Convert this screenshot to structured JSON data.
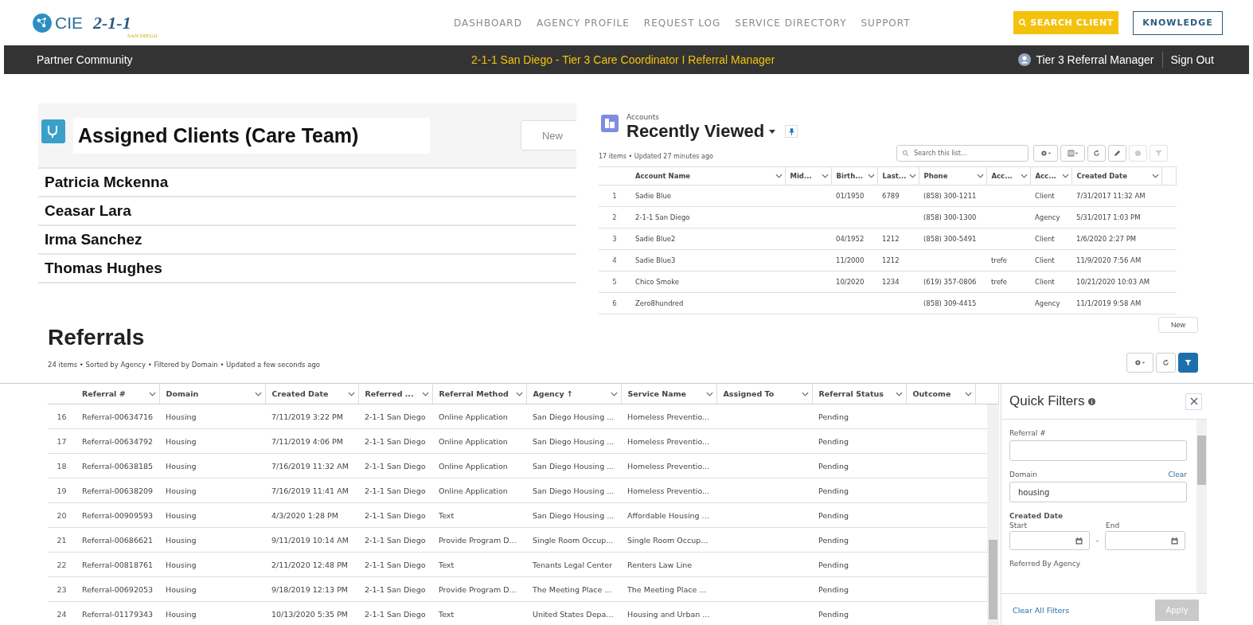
{
  "header": {
    "logo": {
      "brand": "CIE",
      "mark": "2-1-1",
      "tagline": "SAN DIEGO"
    },
    "nav": [
      {
        "label": "DASHBOARD"
      },
      {
        "label": "AGENCY PROFILE"
      },
      {
        "label": "REQUEST LOG"
      },
      {
        "label": "SERVICE DIRECTORY"
      },
      {
        "label": "SUPPORT"
      }
    ],
    "search_button": "SEARCH CLIENT",
    "knowledge_button": "KNOWLEDGE"
  },
  "subbar": {
    "community": "Partner Community",
    "title": "2-1-1 San Diego - Tier 3 Care Coordinator I Referral Manager",
    "user": "Tier 3 Referral Manager",
    "sign_out": "Sign Out"
  },
  "assigned_clients": {
    "title": "Assigned Clients  (Care Team)",
    "new_button": "New",
    "clients": [
      "Patricia Mckenna",
      "Ceasar Lara",
      "Irma Sanchez",
      "Thomas Hughes"
    ]
  },
  "accounts": {
    "object_label": "Accounts",
    "title": "Recently Viewed",
    "summary": "17 items • Updated 27 minutes ago",
    "search": {
      "placeholder": "Search this list..."
    },
    "columns": [
      "Account Name",
      "Mid...",
      "Birth...",
      "Last...",
      "Phone",
      "Acc...",
      "Acc...",
      "Created Date"
    ],
    "rows": [
      {
        "number": "1",
        "cells": [
          "Sadie Blue",
          "",
          "01/1950",
          "6789",
          "(858) 300-1211",
          "",
          "Client",
          "7/31/2017 11:32 AM"
        ]
      },
      {
        "number": "2",
        "cells": [
          "2-1-1 San Diego",
          "",
          "",
          "",
          "(858) 300-1300",
          "",
          "Agency",
          "5/31/2017 1:03 PM"
        ]
      },
      {
        "number": "3",
        "cells": [
          "Sadie Blue2",
          "",
          "04/1952",
          "1212",
          "(858) 300-5491",
          "",
          "Client",
          "1/6/2020 2:27 PM"
        ]
      },
      {
        "number": "4",
        "cells": [
          "Sadie Blue3",
          "",
          "11/2000",
          "1212",
          "",
          "trefe",
          "Client",
          "11/9/2020 7:56 AM"
        ]
      },
      {
        "number": "5",
        "cells": [
          "Chico Smoke",
          "",
          "10/2020",
          "1234",
          "(619) 357-0806",
          "trefe",
          "Client",
          "10/21/2020 10:03 AM"
        ]
      },
      {
        "number": "6",
        "cells": [
          "Zero8hundred",
          "",
          "",
          "",
          "(858) 309-4415",
          "",
          "Agency",
          "11/1/2019 9:58 AM"
        ]
      }
    ]
  },
  "referrals": {
    "title": "Referrals",
    "new_button": "New",
    "summary": "24 items • Sorted by Agency • Filtered by Domain • Updated a few seconds ago",
    "filter_active": true,
    "columns": [
      "Referral #",
      "Domain",
      "Created Date",
      "Referred ...",
      "Referral Method",
      "Agency ↑",
      "Service Name",
      "Assigned To",
      "Referral Status",
      "Outcome"
    ],
    "rows": [
      {
        "number": "16",
        "cells": [
          "Referral-00634716",
          "Housing",
          "7/11/2019 3:22 PM",
          "2-1-1 San Diego",
          "Online Application",
          "San Diego Housing ...",
          "Homeless Preventio...",
          "",
          "Pending",
          ""
        ]
      },
      {
        "number": "17",
        "cells": [
          "Referral-00634792",
          "Housing",
          "7/11/2019 4:06 PM",
          "2-1-1 San Diego",
          "Online Application",
          "San Diego Housing ...",
          "Homeless Preventio...",
          "",
          "Pending",
          ""
        ]
      },
      {
        "number": "18",
        "cells": [
          "Referral-00638185",
          "Housing",
          "7/16/2019 11:32 AM",
          "2-1-1 San Diego",
          "Online Application",
          "San Diego Housing ...",
          "Homeless Preventio...",
          "",
          "Pending",
          ""
        ]
      },
      {
        "number": "19",
        "cells": [
          "Referral-00638209",
          "Housing",
          "7/16/2019 11:41 AM",
          "2-1-1 San Diego",
          "Online Application",
          "San Diego Housing ...",
          "Homeless Preventio...",
          "",
          "Pending",
          ""
        ]
      },
      {
        "number": "20",
        "cells": [
          "Referral-00909593",
          "Housing",
          "4/3/2020 1:28 PM",
          "2-1-1 San Diego",
          "Text",
          "San Diego Housing ...",
          "Affordable Housing ...",
          "",
          "Pending",
          ""
        ]
      },
      {
        "number": "21",
        "cells": [
          "Referral-00686621",
          "Housing",
          "9/11/2019 10:14 AM",
          "2-1-1 San Diego",
          "Provide Program D...",
          "Single Room Occup...",
          "Single Room Occup...",
          "",
          "Pending",
          ""
        ]
      },
      {
        "number": "22",
        "cells": [
          "Referral-00818761",
          "Housing",
          "2/11/2020 12:48 PM",
          "2-1-1 San Diego",
          "Text",
          "Tenants Legal Center",
          "Renters Law Line",
          "",
          "Pending",
          ""
        ]
      },
      {
        "number": "23",
        "cells": [
          "Referral-00692053",
          "Housing",
          "9/18/2019 12:13 PM",
          "2-1-1 San Diego",
          "Provide Program D...",
          "The Meeting Place ...",
          "The Meeting Place ...",
          "",
          "Pending",
          ""
        ]
      },
      {
        "number": "24",
        "cells": [
          "Referral-01179343",
          "Housing",
          "10/13/2020 5:35 PM",
          "2-1-1 San Diego",
          "Text",
          "United States Depa...",
          "Housing and Urban ...",
          "",
          "Pending",
          ""
        ]
      }
    ]
  },
  "quick_filters": {
    "title": "Quick Filters",
    "fields": [
      {
        "kind": "text",
        "label": "Referral #"
      },
      {
        "kind": "text",
        "label": "Domain",
        "value": "housing",
        "clear": "Clear"
      },
      {
        "kind": "daterange",
        "label": "Created Date",
        "start_label": "Start",
        "end_label": "End",
        "separator": "-"
      },
      {
        "kind": "partial",
        "label": "Referred By Agency"
      }
    ],
    "clear_all": "Clear All Filters",
    "apply": {
      "label": "Apply",
      "disabled": true
    }
  }
}
